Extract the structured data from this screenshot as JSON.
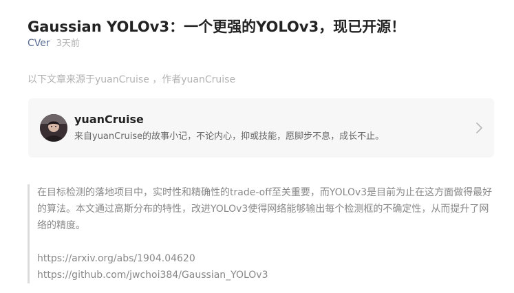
{
  "article": {
    "title": "Gaussian YOLOv3：一个更强的YOLOv3，现已开源！",
    "author": "CVer",
    "time": "3天前",
    "source_line": "以下文章来源于yuanCruise ，作者yuanCruise"
  },
  "profile_card": {
    "name": "yuanCruise",
    "description": "来自yuanCruise的故事小记，不论内心，抑或技能，愿脚步不息，成长不止。",
    "avatar_icon": "avatar-portrait",
    "chevron_icon": "chevron-right-icon"
  },
  "quote": {
    "paragraph": "在目标检测的落地项目中，实时性和精确性的trade-off至关重要，而YOLOv3是目前为止在这方面做得最好的算法。本文通过高斯分布的特性，改进YOLOv3使得网络能够输出每个检测框的不确定性，从而提升了网络的精度。",
    "link1": "https://arxiv.org/abs/1904.04620",
    "link2": "https://github.com/jwchoi384/Gaussian_YOLOv3"
  },
  "colors": {
    "author_link": "#576b95",
    "muted_text": "#b2b2b2",
    "card_background": "#f7f7f7",
    "quote_border": "#dbdbdb"
  }
}
